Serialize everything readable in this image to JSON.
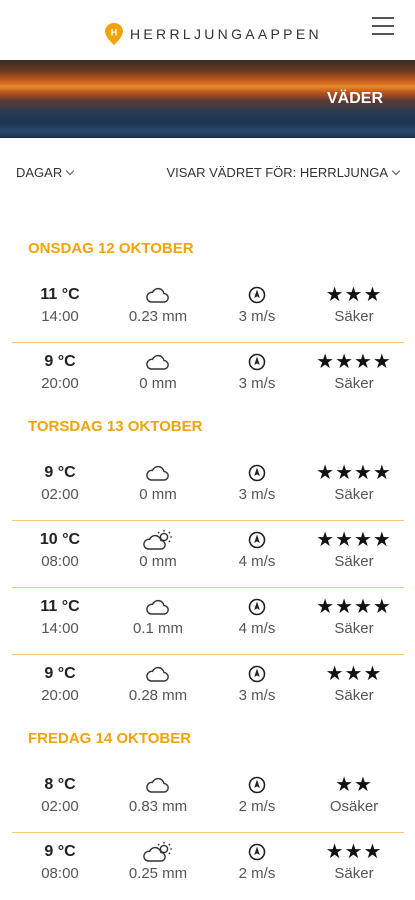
{
  "header": {
    "logo_text": "HERRLJUNGAAPPEN",
    "menu_icon": "hamburger-icon",
    "brand_color": "#f0a30a"
  },
  "banner": {
    "title": "VÄDER"
  },
  "filters": {
    "days_label": "DAGAR",
    "location_label": "VISAR VÄDRET FÖR: HERRLJUNGA"
  },
  "days": [
    {
      "label": "ONSDAG 12 OKTOBER",
      "entries": [
        {
          "temp": "11 °C",
          "time": "14:00",
          "weather_icon": "cloud-icon",
          "precip": "0.23 mm",
          "wind_icon": "wind-direction-icon",
          "wind": "3 m/s",
          "stars": "★★★",
          "rating": "Säker"
        },
        {
          "temp": "9 °C",
          "time": "20:00",
          "weather_icon": "cloud-icon",
          "precip": "0 mm",
          "wind_icon": "wind-direction-icon",
          "wind": "3 m/s",
          "stars": "★★★★",
          "rating": "Säker"
        }
      ]
    },
    {
      "label": "TORSDAG 13 OKTOBER",
      "entries": [
        {
          "temp": "9 °C",
          "time": "02:00",
          "weather_icon": "cloud-icon",
          "precip": "0 mm",
          "wind_icon": "wind-direction-icon",
          "wind": "3 m/s",
          "stars": "★★★★",
          "rating": "Säker"
        },
        {
          "temp": "10 °C",
          "time": "08:00",
          "weather_icon": "partly-sunny-icon",
          "precip": "0 mm",
          "wind_icon": "wind-direction-icon",
          "wind": "4 m/s",
          "stars": "★★★★",
          "rating": "Säker"
        },
        {
          "temp": "11 °C",
          "time": "14:00",
          "weather_icon": "cloud-icon",
          "precip": "0.1 mm",
          "wind_icon": "wind-direction-icon",
          "wind": "4 m/s",
          "stars": "★★★★",
          "rating": "Säker"
        },
        {
          "temp": "9 °C",
          "time": "20:00",
          "weather_icon": "cloud-icon",
          "precip": "0.28 mm",
          "wind_icon": "wind-direction-icon",
          "wind": "3 m/s",
          "stars": "★★★",
          "rating": "Säker"
        }
      ]
    },
    {
      "label": "FREDAG 14 OKTOBER",
      "entries": [
        {
          "temp": "8 °C",
          "time": "02:00",
          "weather_icon": "cloud-icon",
          "precip": "0.83 mm",
          "wind_icon": "wind-direction-icon",
          "wind": "2 m/s",
          "stars": "★★",
          "rating": "Osäker"
        },
        {
          "temp": "9 °C",
          "time": "08:00",
          "weather_icon": "partly-sunny-icon",
          "precip": "0.25 mm",
          "wind_icon": "wind-direction-icon",
          "wind": "2 m/s",
          "stars": "★★★",
          "rating": "Säker"
        }
      ]
    }
  ]
}
